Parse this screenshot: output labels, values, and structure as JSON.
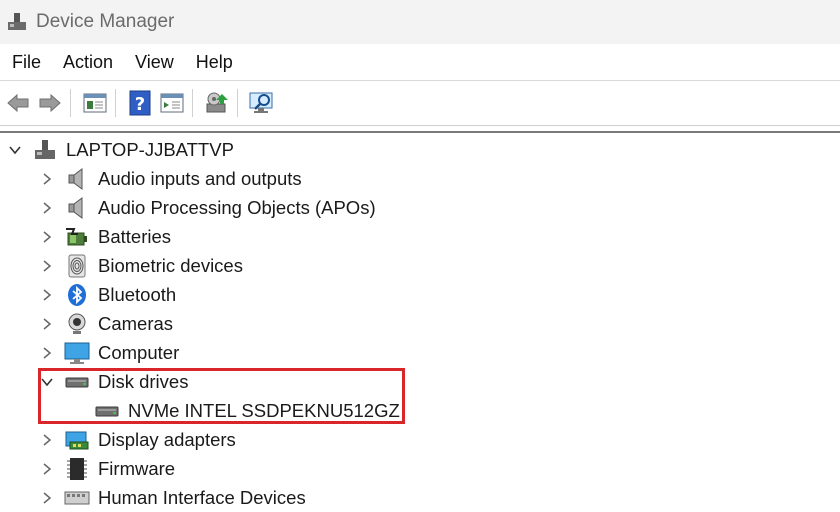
{
  "window": {
    "title": "Device Manager"
  },
  "menu": [
    "File",
    "Action",
    "View",
    "Help"
  ],
  "toolbar": {
    "buttons": [
      "back-arrow-icon",
      "forward-arrow-icon",
      "properties-pane-icon",
      "help-icon",
      "show-pane-icon",
      "update-driver-icon",
      "scan-hardware-icon"
    ]
  },
  "tree": {
    "root": "LAPTOP-JJBATTVP",
    "categories": [
      {
        "label": "Audio inputs and outputs",
        "icon": "speaker-icon"
      },
      {
        "label": "Audio Processing Objects (APOs)",
        "icon": "speaker-icon"
      },
      {
        "label": "Batteries",
        "icon": "battery-icon"
      },
      {
        "label": "Biometric devices",
        "icon": "fingerprint-icon"
      },
      {
        "label": "Bluetooth",
        "icon": "bluetooth-icon"
      },
      {
        "label": "Cameras",
        "icon": "webcam-icon"
      },
      {
        "label": "Computer",
        "icon": "monitor-icon"
      },
      {
        "label": "Disk drives",
        "icon": "disk-drive-icon",
        "expanded": true
      },
      {
        "label": "Display adapters",
        "icon": "display-adapter-icon"
      },
      {
        "label": "Firmware",
        "icon": "firmware-chip-icon"
      },
      {
        "label": "Human Interface Devices",
        "icon": "hid-keyboard-icon"
      }
    ],
    "disk_children": [
      "NVMe INTEL SSDPEKNU512GZ"
    ]
  },
  "colors": {
    "highlight": "#d9262b",
    "titlebar": "#f3f3f3"
  }
}
